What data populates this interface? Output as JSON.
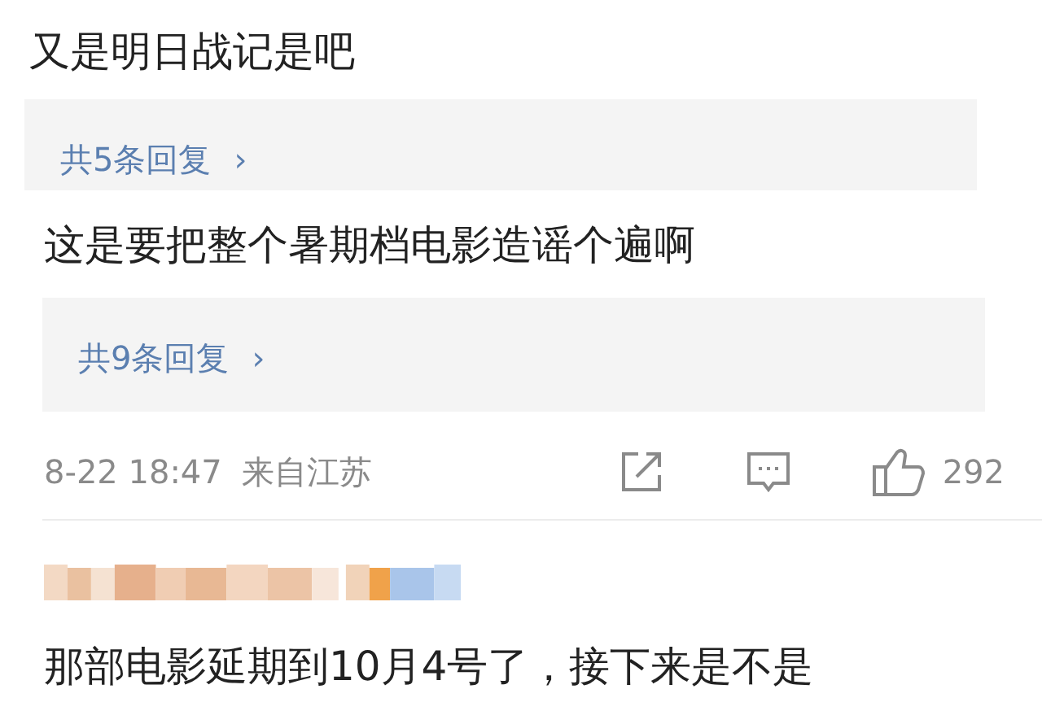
{
  "comments": [
    {
      "text": "又是明日战记是吧",
      "replies": {
        "label": "共5条回复",
        "chevron": "›"
      }
    },
    {
      "text": "这是要把整个暑期档电影造谣个遍啊",
      "replies": {
        "label": "共9条回复",
        "chevron": "›"
      },
      "meta": {
        "time": "8-22 18:47",
        "location": "来自江苏",
        "likes": "292"
      }
    },
    {
      "text": "那部电影延期到10月4号了，接下来是不是"
    }
  ]
}
